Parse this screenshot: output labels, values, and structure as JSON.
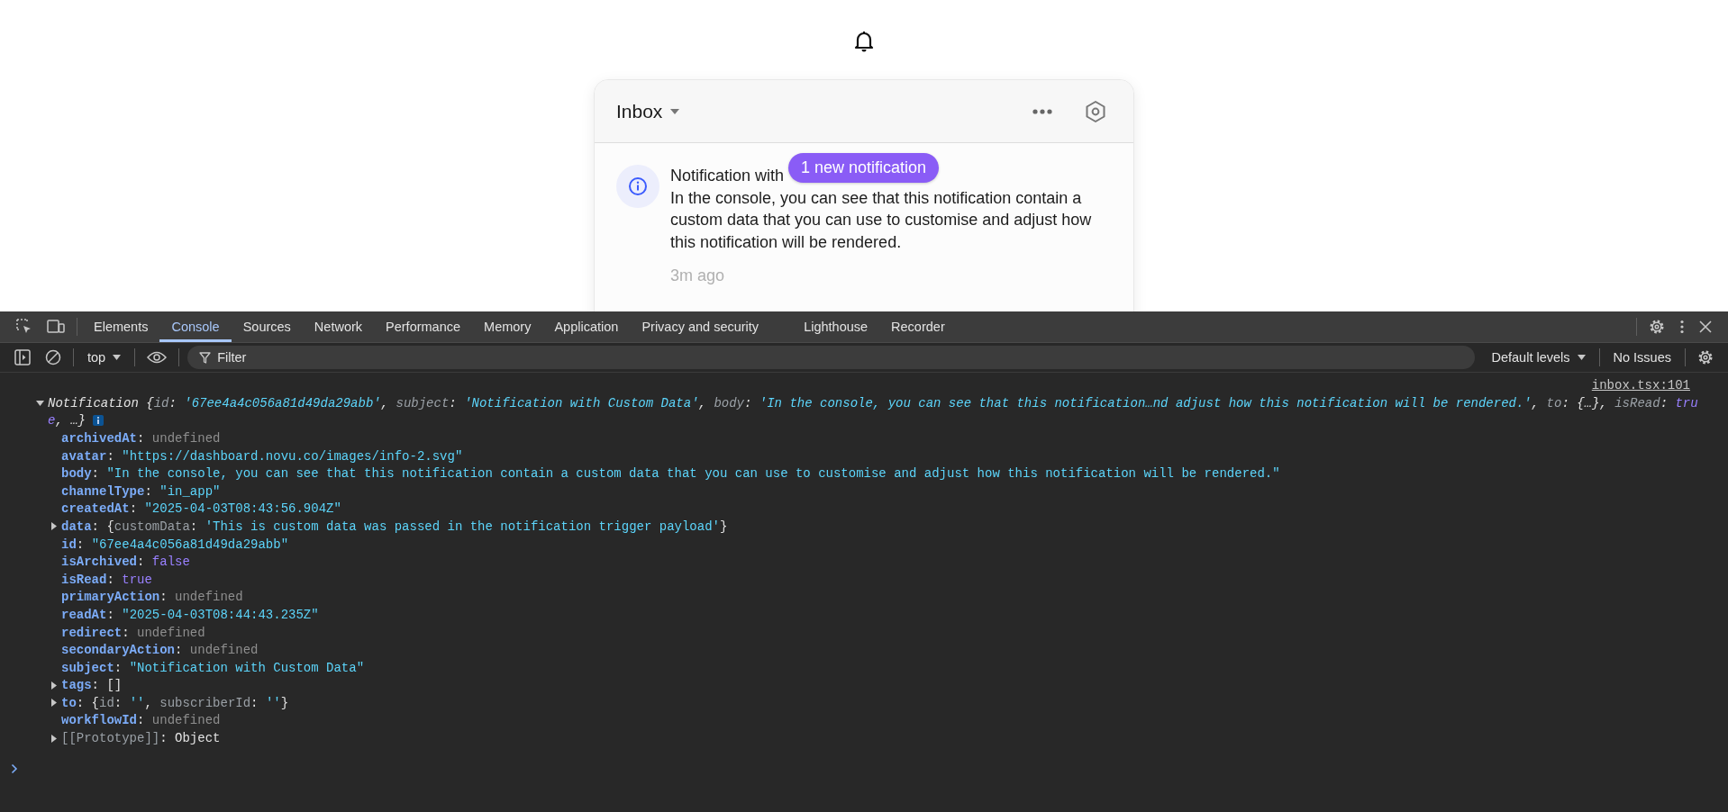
{
  "inbox": {
    "title": "Inbox",
    "notifications": [
      {
        "subject": "Notification with",
        "body": "In the console, you can see that this notification contain a custom data that you can use to customise and adjust how this notification will be rendered.",
        "time": "3m ago"
      }
    ],
    "new_badge": "1 new notification"
  },
  "devtools": {
    "tabs": [
      {
        "label": "Elements",
        "selected": false
      },
      {
        "label": "Console",
        "selected": true
      },
      {
        "label": "Sources",
        "selected": false
      },
      {
        "label": "Network",
        "selected": false
      },
      {
        "label": "Performance",
        "selected": false
      },
      {
        "label": "Memory",
        "selected": false
      },
      {
        "label": "Application",
        "selected": false
      },
      {
        "label": "Privacy and security",
        "selected": false
      },
      {
        "label": "Lighthouse",
        "selected": false
      },
      {
        "label": "Recorder",
        "selected": false
      }
    ],
    "context": "top",
    "filter": {
      "placeholder": "Filter"
    },
    "levels": "Default levels",
    "issues": "No Issues",
    "source_link": "inbox.tsx:101",
    "log": {
      "expanded": true,
      "preview_lines": [
        [
          {
            "text": "Notification {",
            "kind": "text"
          },
          {
            "text": "id",
            "kind": "key"
          },
          {
            "text": ": ",
            "kind": "text"
          },
          {
            "text": "'67ee4a4c056a81d49da29abb'",
            "kind": "string"
          },
          {
            "text": ", ",
            "kind": "text"
          },
          {
            "text": "subject",
            "kind": "key"
          },
          {
            "text": ": ",
            "kind": "text"
          },
          {
            "text": "'Notification with Custom Data'",
            "kind": "string"
          },
          {
            "text": ", ",
            "kind": "text"
          },
          {
            "text": "body",
            "kind": "key"
          },
          {
            "text": ": ",
            "kind": "text"
          },
          {
            "text": "'In the console, you can see that this notification…nd adjust how this notification will be rendered.'",
            "kind": "string"
          },
          {
            "text": ", ",
            "kind": "text"
          },
          {
            "text": "to",
            "kind": "key"
          },
          {
            "text": ": {…}, ",
            "kind": "text"
          },
          {
            "text": "isRead",
            "kind": "key"
          },
          {
            "text": ": ",
            "kind": "text"
          },
          {
            "text": "tru",
            "kind": "keyword"
          }
        ],
        [
          {
            "text": "e",
            "kind": "keyword"
          },
          {
            "text": ", …}",
            "kind": "text"
          }
        ]
      ],
      "properties": [
        {
          "key": "archivedAt",
          "kind": "own",
          "parts": [
            {
              "text": ": ",
              "kind": "text"
            },
            {
              "text": "undefined",
              "kind": "undefined"
            }
          ]
        },
        {
          "key": "avatar",
          "kind": "own",
          "parts": [
            {
              "text": ": ",
              "kind": "text"
            },
            {
              "text": "\"https://dashboard.novu.co/images/info-2.svg\"",
              "kind": "string"
            }
          ]
        },
        {
          "key": "body",
          "kind": "own",
          "parts": [
            {
              "text": ": ",
              "kind": "text"
            },
            {
              "text": "\"In the console, you can see that this notification contain a custom data that you can use to customise and adjust how this notification will be rendered.\"",
              "kind": "string"
            }
          ]
        },
        {
          "key": "channelType",
          "kind": "own",
          "parts": [
            {
              "text": ": ",
              "kind": "text"
            },
            {
              "text": "\"in_app\"",
              "kind": "string"
            }
          ]
        },
        {
          "key": "createdAt",
          "kind": "own",
          "parts": [
            {
              "text": ": ",
              "kind": "text"
            },
            {
              "text": "\"2025-04-03T08:43:56.904Z\"",
              "kind": "string"
            }
          ]
        },
        {
          "key": "data",
          "kind": "own",
          "expanded": false,
          "parts": [
            {
              "text": ": {",
              "kind": "text"
            },
            {
              "text": "customData",
              "kind": "key"
            },
            {
              "text": ": ",
              "kind": "text"
            },
            {
              "text": "'This is custom data was passed in the notification trigger payload'",
              "kind": "string"
            },
            {
              "text": "}",
              "kind": "text"
            }
          ]
        },
        {
          "key": "id",
          "kind": "own",
          "parts": [
            {
              "text": ": ",
              "kind": "text"
            },
            {
              "text": "\"67ee4a4c056a81d49da29abb\"",
              "kind": "string"
            }
          ]
        },
        {
          "key": "isArchived",
          "kind": "own",
          "parts": [
            {
              "text": ": ",
              "kind": "text"
            },
            {
              "text": "false",
              "kind": "keyword"
            }
          ]
        },
        {
          "key": "isRead",
          "kind": "own",
          "parts": [
            {
              "text": ": ",
              "kind": "text"
            },
            {
              "text": "true",
              "kind": "keyword"
            }
          ]
        },
        {
          "key": "primaryAction",
          "kind": "own",
          "parts": [
            {
              "text": ": ",
              "kind": "text"
            },
            {
              "text": "undefined",
              "kind": "undefined"
            }
          ]
        },
        {
          "key": "readAt",
          "kind": "own",
          "parts": [
            {
              "text": ": ",
              "kind": "text"
            },
            {
              "text": "\"2025-04-03T08:44:43.235Z\"",
              "kind": "string"
            }
          ]
        },
        {
          "key": "redirect",
          "kind": "own",
          "parts": [
            {
              "text": ": ",
              "kind": "text"
            },
            {
              "text": "undefined",
              "kind": "undefined"
            }
          ]
        },
        {
          "key": "secondaryAction",
          "kind": "own",
          "parts": [
            {
              "text": ": ",
              "kind": "text"
            },
            {
              "text": "undefined",
              "kind": "undefined"
            }
          ]
        },
        {
          "key": "subject",
          "kind": "own",
          "parts": [
            {
              "text": ": ",
              "kind": "text"
            },
            {
              "text": "\"Notification with Custom Data\"",
              "kind": "string"
            }
          ]
        },
        {
          "key": "tags",
          "kind": "own",
          "expanded": false,
          "parts": [
            {
              "text": ": []",
              "kind": "text"
            }
          ]
        },
        {
          "key": "to",
          "kind": "own",
          "expanded": false,
          "parts": [
            {
              "text": ": {",
              "kind": "text"
            },
            {
              "text": "id",
              "kind": "key"
            },
            {
              "text": ": ",
              "kind": "text"
            },
            {
              "text": "''",
              "kind": "string"
            },
            {
              "text": ", ",
              "kind": "text"
            },
            {
              "text": "subscriberId",
              "kind": "key"
            },
            {
              "text": ": ",
              "kind": "text"
            },
            {
              "text": "''",
              "kind": "string"
            },
            {
              "text": "}",
              "kind": "text"
            }
          ]
        },
        {
          "key": "workflowId",
          "kind": "own",
          "parts": [
            {
              "text": ": ",
              "kind": "text"
            },
            {
              "text": "undefined",
              "kind": "undefined"
            }
          ]
        },
        {
          "key": "[[Prototype]]",
          "kind": "internal",
          "expanded": false,
          "parts": [
            {
              "text": ": ",
              "kind": "text"
            },
            {
              "text": "Object",
              "kind": "text"
            }
          ]
        }
      ]
    }
  }
}
